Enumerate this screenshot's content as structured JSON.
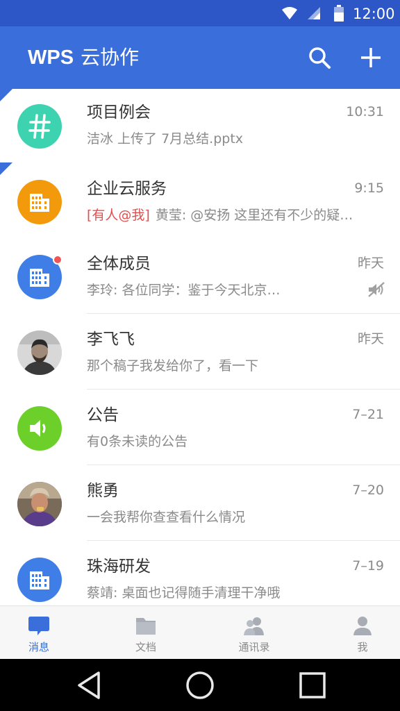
{
  "status_bar": {
    "time": "12:00",
    "icons": [
      "wifi-icon",
      "signal-icon",
      "battery-icon"
    ]
  },
  "app_bar": {
    "brand": "WPS",
    "subtitle": "云协作",
    "actions": [
      "search-icon",
      "add-icon"
    ]
  },
  "colors": {
    "primary": "#3a6edb",
    "status_bar": "#2d56c6",
    "mention": "#e05050",
    "unread_dot": "#f05454"
  },
  "conversations": [
    {
      "title": "项目例会",
      "time": "10:31",
      "preview": "洁冰 上传了 7月总结.pptx",
      "avatar": "hash-icon",
      "avatar_color": "#3ed3b0",
      "pinned": true
    },
    {
      "title": "企业云服务",
      "time": "9:15",
      "mention": "[有人@我]",
      "preview": "黄莹: @安扬 这里还有不少的疑…",
      "avatar": "building-icon",
      "avatar_color": "#f29a0c"
    },
    {
      "title": "全体成员",
      "time": "昨天",
      "preview": "李玲: 各位同学：鉴于今天北京…",
      "avatar": "building-icon",
      "avatar_color": "#3f7ee6",
      "unread": true,
      "muted": true
    },
    {
      "title": "李飞飞",
      "time": "昨天",
      "preview": "那个稿子我发给你了，看一下",
      "avatar": "user-photo"
    },
    {
      "title": "公告",
      "time": "7–21",
      "preview": "有0条未读的公告",
      "avatar": "speaker-icon",
      "avatar_color": "#6ccf2a"
    },
    {
      "title": "熊勇",
      "time": "7–20",
      "preview": "一会我帮你查查看什么情况",
      "avatar": "user-photo"
    },
    {
      "title": "珠海研发",
      "time": "7–19",
      "preview": "蔡靖: 桌面也记得随手清理干净哦",
      "avatar": "building-icon",
      "avatar_color": "#3f7ee6"
    }
  ],
  "bottom_nav": {
    "tabs": [
      {
        "label": "消息",
        "icon": "message-icon",
        "active": true
      },
      {
        "label": "文档",
        "icon": "folder-icon"
      },
      {
        "label": "通讯录",
        "icon": "contacts-icon"
      },
      {
        "label": "我",
        "icon": "person-icon"
      }
    ]
  },
  "system_nav": [
    "back-icon",
    "home-icon",
    "recents-icon"
  ]
}
